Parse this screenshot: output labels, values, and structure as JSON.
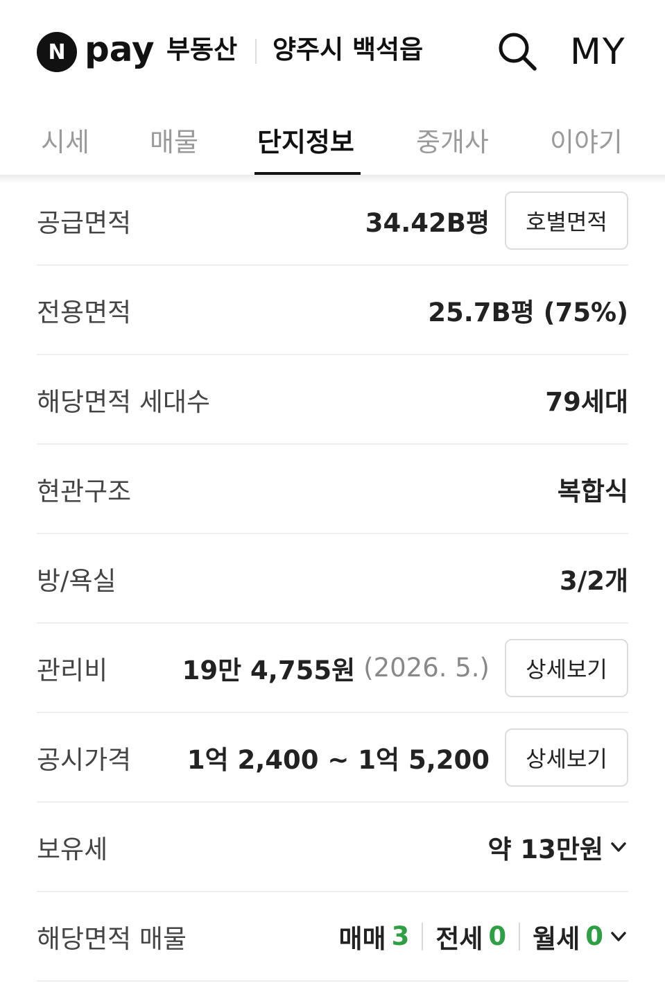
{
  "header": {
    "logo_n": "N",
    "logo_pay": "pay",
    "service": "부동산",
    "location": "양주시 백석읍",
    "my_label": "MY"
  },
  "tabs": [
    {
      "label": "시세",
      "active": false
    },
    {
      "label": "매물",
      "active": false
    },
    {
      "label": "단지정보",
      "active": true
    },
    {
      "label": "중개사",
      "active": false
    },
    {
      "label": "이야기",
      "active": false
    }
  ],
  "rows": {
    "supply_area": {
      "label": "공급면적",
      "value": "34.42B평",
      "button": "호별면적"
    },
    "exclusive_area": {
      "label": "전용면적",
      "value": "25.7B평 (75%)"
    },
    "households": {
      "label": "해당면적 세대수",
      "value": "79세대"
    },
    "entrance": {
      "label": "현관구조",
      "value": "복합식"
    },
    "rooms": {
      "label": "방/욕실",
      "value": "3/2개"
    },
    "maintenance": {
      "label": "관리비",
      "value": "19만 4,755원",
      "date": "(2026. 5.)",
      "button": "상세보기"
    },
    "official_price": {
      "label": "공시가격",
      "value": "1억 2,400 ~ 1억 5,200",
      "button": "상세보기"
    },
    "holding_tax": {
      "label": "보유세",
      "value": "약 13만원"
    },
    "listings": {
      "label": "해당면적 매물",
      "sale_label": "매매",
      "sale_count": "3",
      "jeonse_label": "전세",
      "jeonse_count": "0",
      "monthly_label": "월세",
      "monthly_count": "0"
    }
  },
  "icons": {
    "search": "search-icon",
    "chevron": "chevron-down-icon"
  },
  "colors": {
    "accent_green": "#2ea043",
    "text_primary": "#222222",
    "text_muted": "#888888"
  }
}
